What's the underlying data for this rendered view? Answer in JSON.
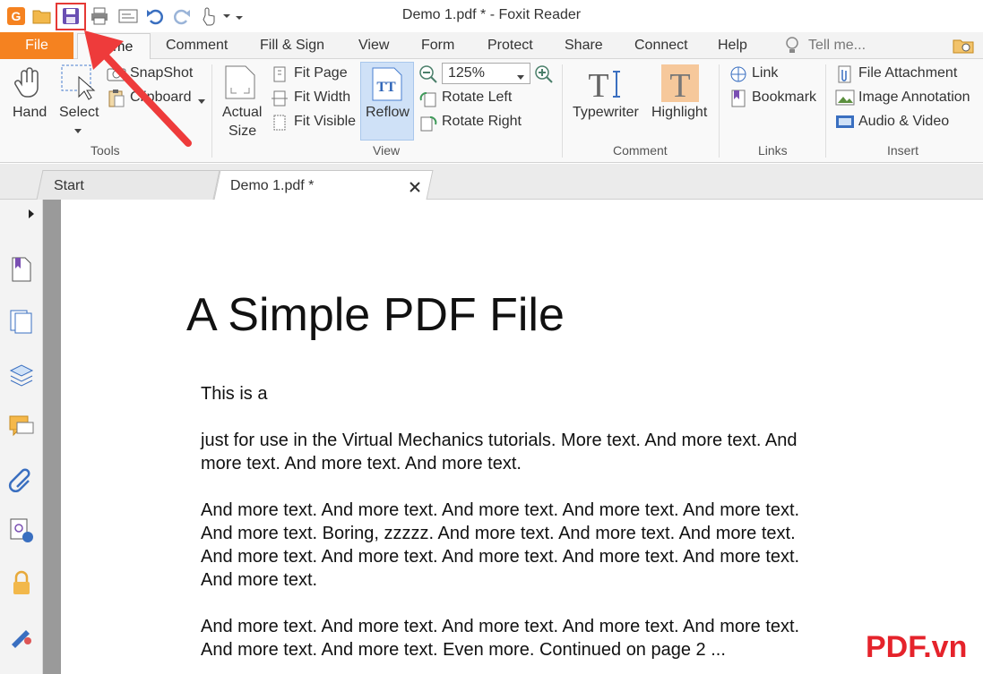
{
  "window": {
    "title": "Demo 1.pdf * - Foxit Reader"
  },
  "menu": {
    "file": "File",
    "tabs": [
      "Home",
      "Comment",
      "Fill & Sign",
      "View",
      "Form",
      "Protect",
      "Share",
      "Connect",
      "Help"
    ],
    "tell_me": "Tell me..."
  },
  "ribbon": {
    "tools": {
      "hand": "Hand",
      "select": "Select",
      "snapshot": "SnapShot",
      "clipboard": "Clipboard",
      "label": "Tools"
    },
    "view": {
      "actual_size_line1": "Actual",
      "actual_size_line2": "Size",
      "fit_page": "Fit Page",
      "fit_width": "Fit Width",
      "fit_visible": "Fit Visible",
      "reflow": "Reflow",
      "zoom_value": "125%",
      "rotate_left": "Rotate Left",
      "rotate_right": "Rotate Right",
      "label": "View"
    },
    "comment": {
      "typewriter": "Typewriter",
      "highlight": "Highlight",
      "label": "Comment"
    },
    "links": {
      "link": "Link",
      "bookmark": "Bookmark",
      "label": "Links"
    },
    "insert": {
      "file_attachment": "File Attachment",
      "image_annotation": "Image Annotation",
      "audio_video": "Audio & Video",
      "label": "Insert"
    }
  },
  "doc_tabs": {
    "start": "Start",
    "demo": "Demo 1.pdf *"
  },
  "document": {
    "title": "A Simple PDF File",
    "p1": "This is a",
    "p2": "just for use in the Virtual Mechanics tutorials. More text. And more text. And more text. And more text. And more text.",
    "p3": "And more text. And more text. And more text. And more text. And more text. And more text. Boring, zzzzz. And more text. And more text. And more text. And more text. And more text. And more text. And more text. And more text. And more text.",
    "p4": "And more text. And more text. And more text. And more text. And more text. And more text. And more text. Even more. Continued on page 2 ..."
  },
  "watermark": "PDF.vn",
  "colors": {
    "file_tab": "#f58220",
    "annotation_red": "#e53935",
    "brand_red": "#e5232b"
  }
}
